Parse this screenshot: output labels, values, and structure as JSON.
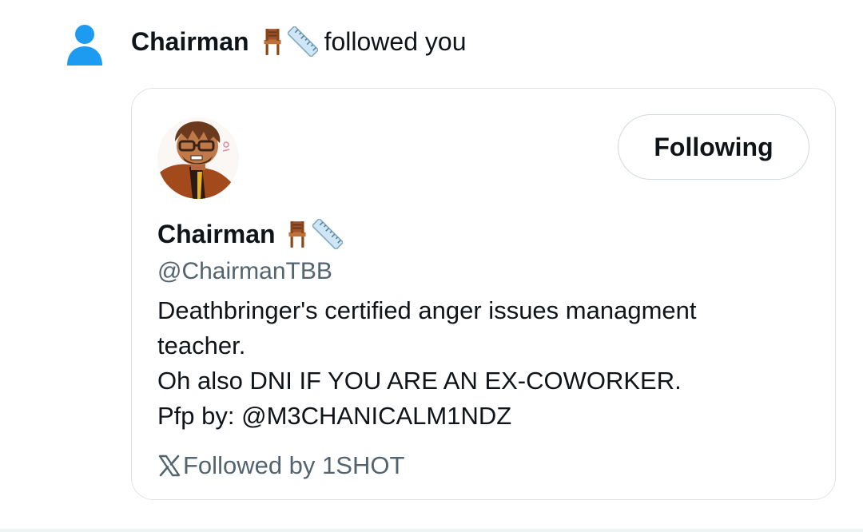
{
  "notification": {
    "actor_name": "Chairman",
    "action_text": "followed you",
    "emojis": [
      "chair-icon",
      "ruler-icon"
    ],
    "icon": "person-icon",
    "icon_color": "#1d9bf0"
  },
  "card": {
    "avatar": "avatar",
    "follow_button_label": "Following",
    "display_name": "Chairman",
    "handle": "@ChairmanTBB",
    "bio_lines": [
      "Deathbringer's certified anger issues managment",
      "teacher.",
      "Oh also DNI IF YOU ARE AN EX-COWORKER.",
      "Pfp by: @M3CHANICALM1NDZ"
    ],
    "followed_by_icon": "x-logo-icon",
    "followed_by_text": "Followed by 1SHOT"
  },
  "colors": {
    "text_primary": "#0f1419",
    "text_secondary": "#536471",
    "border": "#dfe3e6",
    "accent": "#1d9bf0"
  }
}
